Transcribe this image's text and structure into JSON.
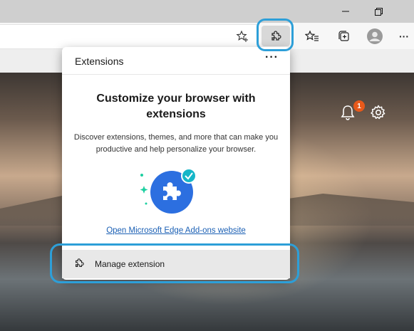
{
  "titlebar": {
    "minimize_icon": "minimize-icon",
    "restore_icon": "restore-icon"
  },
  "toolbar": {
    "favorite_add_icon": "star-plus-icon",
    "extensions_icon": "puzzle-icon",
    "favorites_icon": "favorites-star-icon",
    "collections_icon": "collections-icon",
    "profile_icon": "avatar-icon",
    "more_label": "···"
  },
  "page": {
    "notification_count": "1",
    "bell_icon": "bell-icon",
    "settings_icon": "gear-icon"
  },
  "extensions_popup": {
    "title": "Extensions",
    "more_label": "···",
    "headline": "Customize your browser with extensions",
    "description": "Discover extensions, themes, and more that can make you productive and help personalize your browser.",
    "addons_link": "Open Microsoft Edge Add-ons website",
    "manage_label": "Manage extension",
    "manage_icon": "puzzle-icon"
  },
  "colors": {
    "accent_link": "#1a5fb4",
    "highlight": "#2d9fd8",
    "badge": "#e8591a",
    "illustration_blue": "#2c6fe0",
    "check_teal": "#16b6c8"
  }
}
